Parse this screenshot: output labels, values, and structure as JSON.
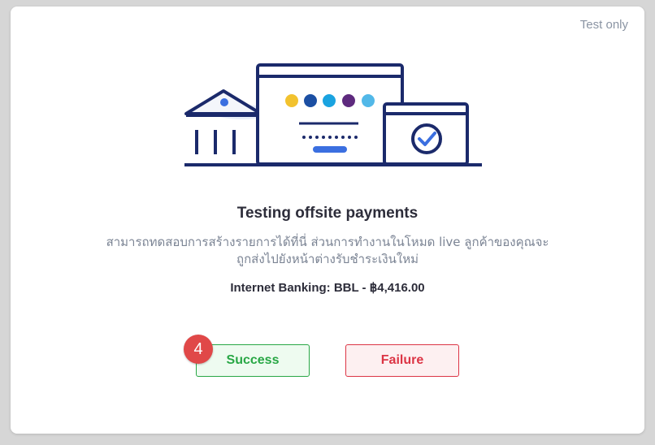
{
  "badge": {
    "label": "Test only"
  },
  "heading": {
    "title": "Testing offsite payments"
  },
  "description": {
    "line1": "สามารถทดสอบการสร้างรายการได้ที่นี่ ส่วนการทำงานในโหมด live ลูกค้าของคุณจะ",
    "line2": "ถูกส่งไปยังหน้าต่างรับชำระเงินใหม่"
  },
  "payment": {
    "summary": "Internet Banking: BBL - ฿4,416.00"
  },
  "actions": {
    "success_label": "Success",
    "failure_label": "Failure",
    "step_number": "4"
  },
  "illustration": {
    "bank_logo_colors": [
      "#f2c22e",
      "#1b4fa3",
      "#1aa3e0",
      "#5e2a7e",
      "#52b8e8"
    ],
    "primary_color": "#1b2a6b",
    "accent_color": "#3b6fe0",
    "check_icon": "check-circle-icon",
    "bank_icon": "bank-building-icon"
  },
  "colors": {
    "success": "#28a745",
    "failure": "#dc3545",
    "step_marker": "#e04848"
  }
}
